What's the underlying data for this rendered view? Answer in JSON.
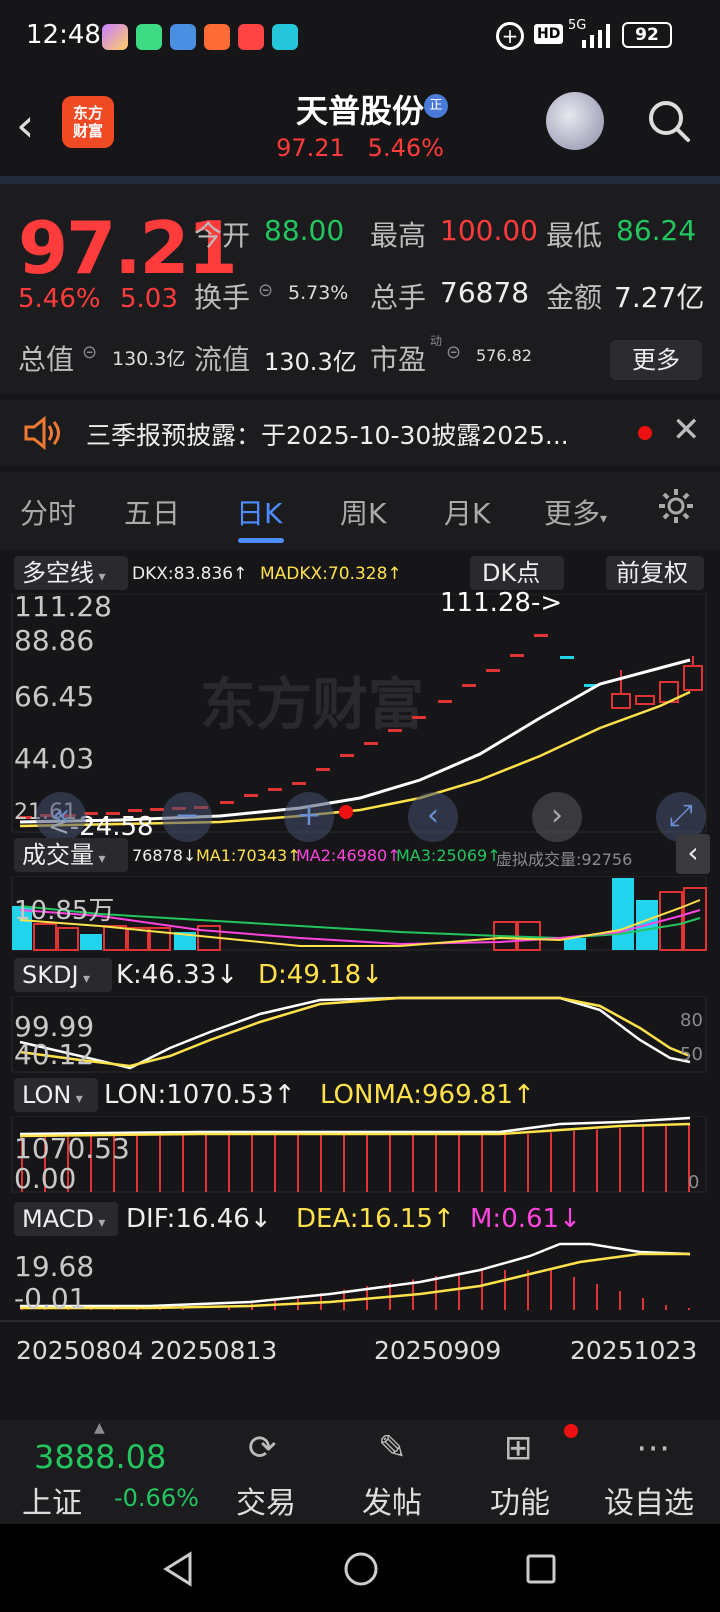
{
  "status": {
    "time": "12:48",
    "network": "5G",
    "battery": "92",
    "hd": "HD"
  },
  "header": {
    "title": "天普股份",
    "badge": "正",
    "price": "97.21",
    "change_pct": "5.46%",
    "logo_line1": "东方",
    "logo_line2": "财富"
  },
  "quote": {
    "price": "97.21",
    "pct": "5.46%",
    "change": "5.03",
    "open_label": "今开",
    "open": "88.00",
    "high_label": "最高",
    "high": "100.00",
    "low_label": "最低",
    "low": "86.24",
    "turnover_label": "换手",
    "turnover": "5.73%",
    "vol_label": "总手",
    "vol": "76878",
    "amount_label": "金额",
    "amount": "7.27亿",
    "mcap_label": "总值",
    "mcap": "130.3亿",
    "float_label": "流值",
    "float": "130.3亿",
    "pe_label": "市盈",
    "pe_sup": "动",
    "pe": "576.82",
    "more": "更多"
  },
  "notice": {
    "text": "三季报预披露：于2025-10-30披露2025..."
  },
  "tabs": [
    "分时",
    "五日",
    "日K",
    "周K",
    "月K",
    "更多"
  ],
  "kline": {
    "indicator": "多空线",
    "dkx": "DKX:83.836↑",
    "madkx": "MADKX:70.328↑",
    "dk_button": "DK点",
    "fq_button": "前复权",
    "axis": [
      "111.28",
      "88.86",
      "66.45",
      "44.03",
      "21.61"
    ],
    "high_mark": "111.28->",
    "low_mark": "<-24.58",
    "watermark": "东方财富"
  },
  "volume": {
    "indicator": "成交量",
    "vol": "76878↓",
    "ma1": "MA1:70343↑",
    "ma2": "MA2:46980↑",
    "ma3": "MA3:25069↑",
    "virtual": "虚拟成交量:92756",
    "axis": "10.85万"
  },
  "skdj": {
    "indicator": "SKDJ",
    "k": "K:46.33↓",
    "d": "D:49.18↓",
    "axis_top": "99.99",
    "axis_bot": "40.12",
    "r80": "80",
    "r50": "50"
  },
  "lon": {
    "indicator": "LON",
    "lon": "LON:1070.53↑",
    "lonma": "LONMA:969.81↑",
    "axis_top": "1070.53",
    "axis_bot": "0.00",
    "r0": "0"
  },
  "macd": {
    "indicator": "MACD",
    "dif": "DIF:16.46↓",
    "dea": "DEA:16.15↑",
    "m": "M:0.61↓",
    "axis_top": "19.68",
    "axis_bot": "-0.01"
  },
  "dates": [
    "20250804",
    "20250813",
    "20250909",
    "20251023"
  ],
  "bottom": {
    "index_value": "3888.08",
    "index_name": "上证",
    "index_pct": "-0.66%",
    "trade": "交易",
    "post": "发帖",
    "func": "功能",
    "watch": "设自选"
  }
}
